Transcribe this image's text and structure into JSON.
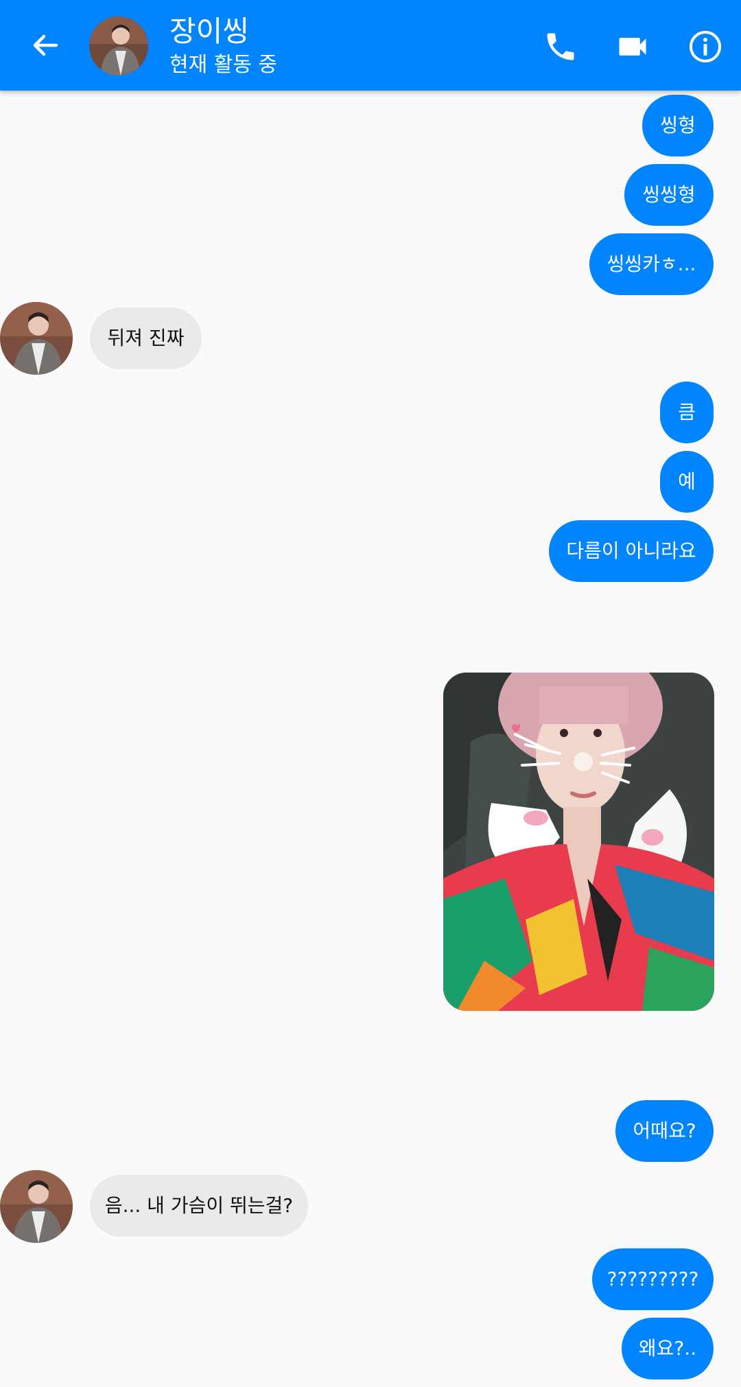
{
  "header": {
    "contact_name": "장이씽",
    "status": "현재 활동 중"
  },
  "icons": {
    "back": "back-arrow-icon",
    "call": "phone-icon",
    "video": "video-camera-icon",
    "info": "info-icon"
  },
  "colors": {
    "brand_blue": "#0084ff",
    "incoming_bubble": "#eaeaea",
    "background": "#fafafa"
  },
  "messages": [
    {
      "direction": "outgoing",
      "text": "씽형"
    },
    {
      "direction": "outgoing",
      "text": "씽씽형"
    },
    {
      "direction": "outgoing",
      "text": "씽씽카ㅎ..."
    },
    {
      "direction": "incoming",
      "text": "뒤져 진짜"
    },
    {
      "direction": "outgoing",
      "text": "큼"
    },
    {
      "direction": "outgoing",
      "text": "예"
    },
    {
      "direction": "outgoing",
      "text": "다름이 아니라요"
    },
    {
      "direction": "outgoing",
      "type": "photo"
    },
    {
      "direction": "outgoing",
      "text": "어때요?"
    },
    {
      "direction": "incoming",
      "text": "음... 내 가슴이 뛰는걸?"
    },
    {
      "direction": "outgoing",
      "text": "?????????"
    },
    {
      "direction": "outgoing",
      "text": "왜요?.."
    }
  ]
}
